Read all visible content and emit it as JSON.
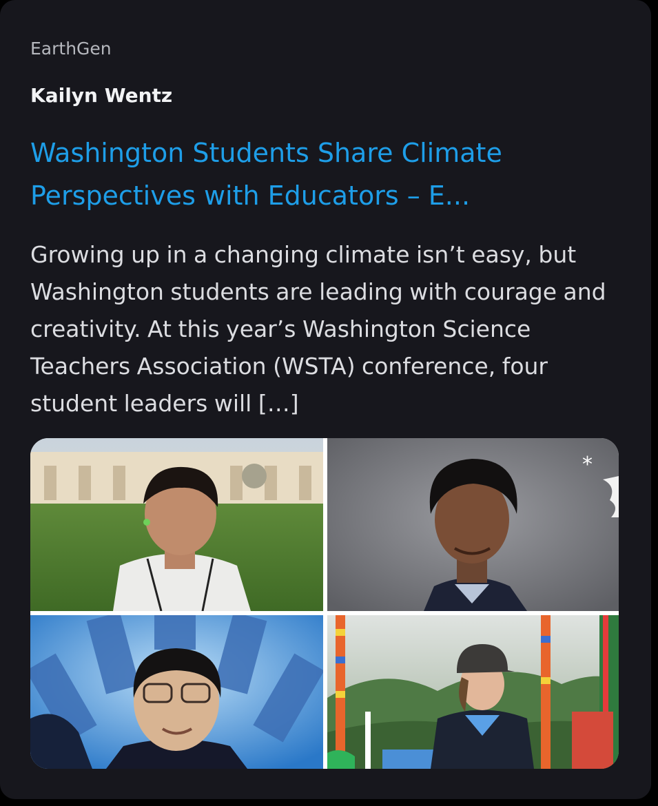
{
  "embed": {
    "site_name": "EarthGen",
    "author": "Kailyn Wentz",
    "title": "Washington Students Share Climate Perspectives with Educators – E...",
    "description": "Growing up in a changing climate isn’t easy, but Washington students are leading with courage and creativity. At this year’s Washington Science Teachers Association (WSTA) conference, four student leaders will […]"
  },
  "colors": {
    "card_background": "#17171d",
    "link": "#1e9ee8",
    "text_primary": "#f2f3f5",
    "text_secondary": "#dcdde1",
    "muted": "#b6b8be"
  },
  "gallery": {
    "photos": [
      {
        "subject": "student-photo-outdoor-lawn"
      },
      {
        "subject": "student-photo-gray-portrait"
      },
      {
        "subject": "student-photo-blue-background"
      },
      {
        "subject": "student-photo-mountain-flags"
      }
    ]
  }
}
